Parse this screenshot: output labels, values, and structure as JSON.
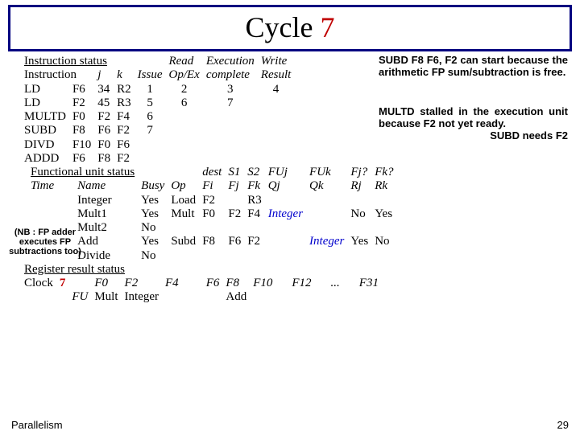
{
  "title": {
    "word": "Cycle ",
    "num": "7"
  },
  "instr_status_label": "Instruction status",
  "instr_headers": {
    "instr": "Instruction",
    "j": "j",
    "k": "k",
    "issue": "Issue",
    "read": "Read",
    "opex": "Op/Ex",
    "exec": "Execution",
    "complete": "complete",
    "write": "Write",
    "result": "Result"
  },
  "instrs": [
    {
      "op": "LD",
      "d": "F6",
      "j": "34",
      "k": "R2",
      "issue": "1",
      "read": "2",
      "exec": "3",
      "write": "4"
    },
    {
      "op": "LD",
      "d": "F2",
      "j": "45",
      "k": "R3",
      "issue": "5",
      "read": "6",
      "exec": "7",
      "write": ""
    },
    {
      "op": "MULTD",
      "d": "F0",
      "j": "F2",
      "k": "F4",
      "issue": "6",
      "read": "",
      "exec": "",
      "write": ""
    },
    {
      "op": "SUBD",
      "d": "F8",
      "j": "F6",
      "k": "F2",
      "issue": "7",
      "read": "",
      "exec": "",
      "write": ""
    },
    {
      "op": "DIVD",
      "d": "F10",
      "j": "F0",
      "k": "F6",
      "issue": "",
      "read": "",
      "exec": "",
      "write": ""
    },
    {
      "op": "ADDD",
      "d": "F6",
      "j": "F8",
      "k": "F2",
      "issue": "",
      "read": "",
      "exec": "",
      "write": ""
    }
  ],
  "fu_status_label": "Functional unit status",
  "fu_headers": {
    "time": "Time",
    "name": "Name",
    "busy": "Busy",
    "op": "Op",
    "dest": "dest",
    "fi": "Fi",
    "s1": "S1",
    "fj": "Fj",
    "s2": "S2",
    "fk": "Fk",
    "fuj": "FUj",
    "qj": "Qj",
    "fuk": "FUk",
    "qk": "Qk",
    "fjq": "Fj?",
    "rj": "Rj",
    "fkq": "Fk?",
    "rk": "Rk"
  },
  "fus": [
    {
      "name": "Integer",
      "busy": "Yes",
      "op": "Load",
      "fi": "F2",
      "fj": "",
      "fk": "R3",
      "qj": "",
      "qk": "",
      "rj": "",
      "rk": ""
    },
    {
      "name": "Mult1",
      "busy": "Yes",
      "op": "Mult",
      "fi": "F0",
      "fj": "F2",
      "fk": "F4",
      "qj": "Integer",
      "qk": "",
      "rj": "No",
      "rk": "Yes"
    },
    {
      "name": "Mult2",
      "busy": "No",
      "op": "",
      "fi": "",
      "fj": "",
      "fk": "",
      "qj": "",
      "qk": "",
      "rj": "",
      "rk": ""
    },
    {
      "name": "Add",
      "busy": "Yes",
      "op": "Subd",
      "fi": "F8",
      "fj": "F6",
      "fk": "F2",
      "qj": "",
      "qk": "Integer",
      "rj": "Yes",
      "rk": "No"
    },
    {
      "name": "Divide",
      "busy": "No",
      "op": "",
      "fi": "",
      "fj": "",
      "fk": "",
      "qj": "",
      "qk": "",
      "rj": "",
      "rk": ""
    }
  ],
  "reg_status_label": "Register result status",
  "reg": {
    "clock_label": "Clock",
    "clock_val": "7",
    "fu_label": "FU",
    "cols": [
      "F0",
      "F2",
      "F4",
      "F6",
      "F8",
      "F10",
      "F12",
      "...",
      "F31"
    ],
    "vals": [
      "Mult",
      "Integer",
      "",
      "",
      "Add",
      "",
      "",
      "",
      ""
    ]
  },
  "annot1": "SUBD F8 F6, F2 can start because the arithmetic FP sum/subtraction is free.",
  "annot2a": "MULTD stalled in the execution unit because F2 not yet ready.",
  "annot2b": "SUBD needs F2",
  "nb_note": "(NB : FP adder executes FP subtractions too)",
  "footer_left": "Parallelism",
  "footer_right": "29"
}
